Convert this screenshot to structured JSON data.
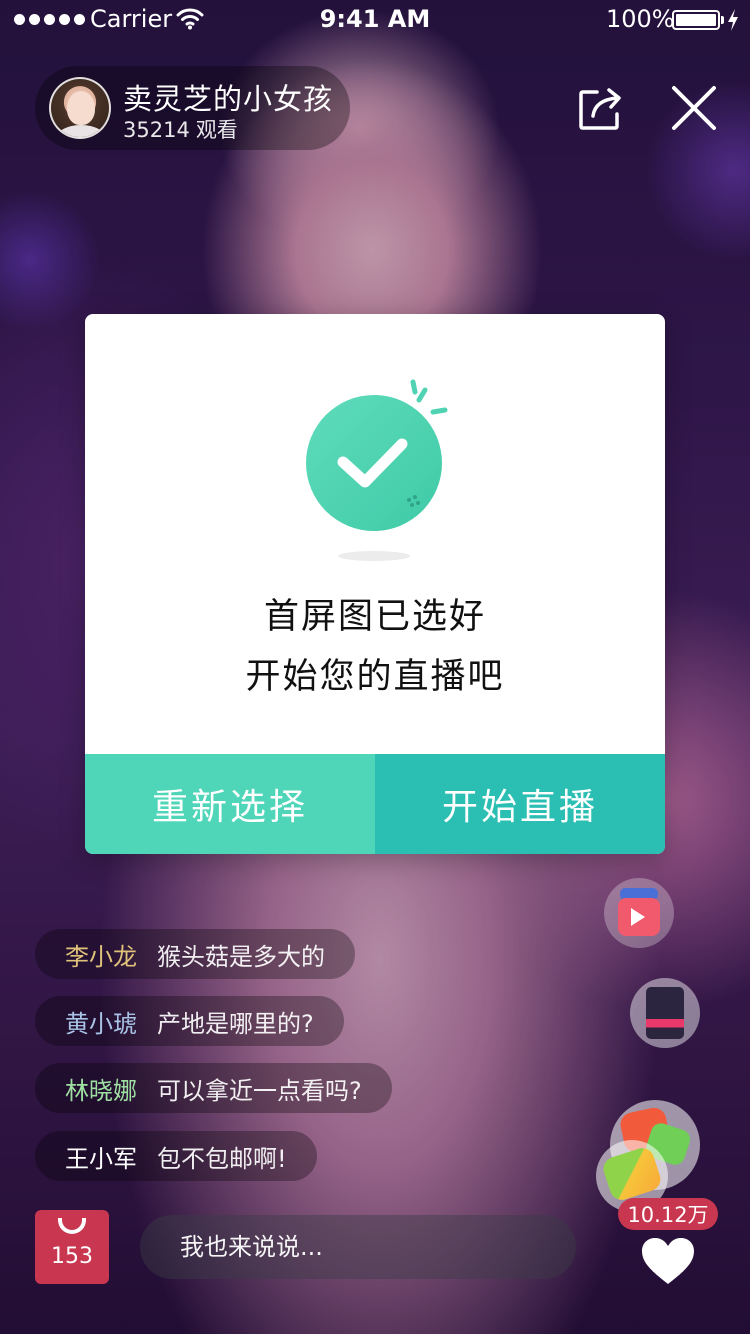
{
  "status_bar": {
    "carrier": "Carrier",
    "time": "9:41 AM",
    "battery": "100%"
  },
  "host": {
    "name": "卖灵芝的小女孩",
    "viewer_count": "35214",
    "viewer_label": "观看"
  },
  "modal": {
    "line1": "首屏图已选好",
    "line2": "开始您的直播吧",
    "reselect_label": "重新选择",
    "start_label": "开始直播",
    "colors": {
      "reselect": "#4fd5b8",
      "start": "#2bbfb4",
      "check_circle": "#4fd3b3"
    }
  },
  "chat": [
    {
      "user": "李小龙",
      "message": "猴头菇是多大的",
      "user_color": "#e0c27a"
    },
    {
      "user": "黄小琥",
      "message": "产地是哪里的?",
      "user_color": "#a9c4e6"
    },
    {
      "user": "林晓娜",
      "message": "可以拿近一点看吗?",
      "user_color": "#9fe0a2"
    },
    {
      "user": "王小军",
      "message": "包不包邮啊!",
      "user_color": "#ffffff"
    }
  ],
  "bottom": {
    "bag_count": "153",
    "comment_placeholder": "我也来说说...",
    "like_count": "10.12万"
  },
  "icons": {
    "share": "share-icon",
    "close": "close-icon",
    "bag": "shopping-bag-icon",
    "heart": "heart-icon"
  }
}
